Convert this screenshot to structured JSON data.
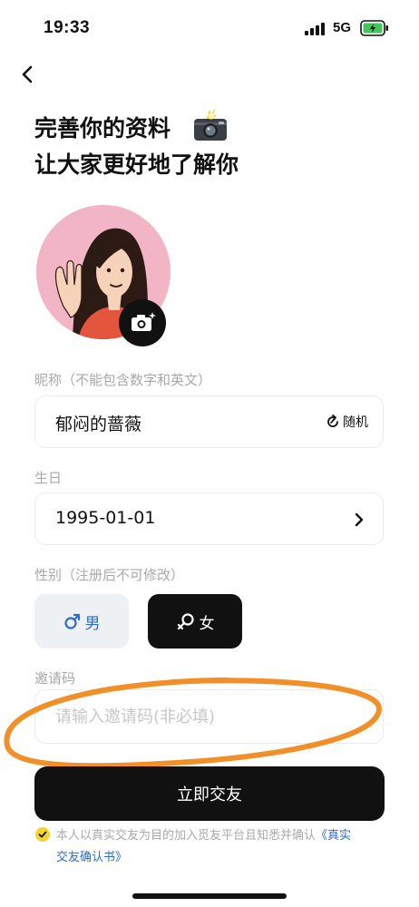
{
  "status_bar": {
    "time": "19:33",
    "network": "5G"
  },
  "header": {
    "title_line1": "完善你的资料",
    "title_line2": "让大家更好地了解你"
  },
  "nickname": {
    "label": "昵称（不能包含数字和英文）",
    "value": "郁闷的蔷薇",
    "random_label": "随机"
  },
  "birthday": {
    "label": "生日",
    "value": "1995-01-01"
  },
  "gender": {
    "label": "性别（注册后不可修改）",
    "male_label": "男",
    "female_label": "女",
    "selected": "女"
  },
  "invite": {
    "label": "邀请码",
    "placeholder": "请输入邀请码(非必填)",
    "value": ""
  },
  "submit": {
    "label": "立即交友"
  },
  "agreement": {
    "text": "本人以真实交友为目的加入觅友平台且知悉并确认",
    "link_part1": "《真实",
    "link_part2": "交友确认书》",
    "checked": true
  },
  "colors": {
    "accent": "#111111",
    "male_blue": "#2b6ec9",
    "avatar_bg": "#f2b5c5",
    "check_yellow": "#f5d431",
    "scribble_orange": "#f08a1c"
  }
}
